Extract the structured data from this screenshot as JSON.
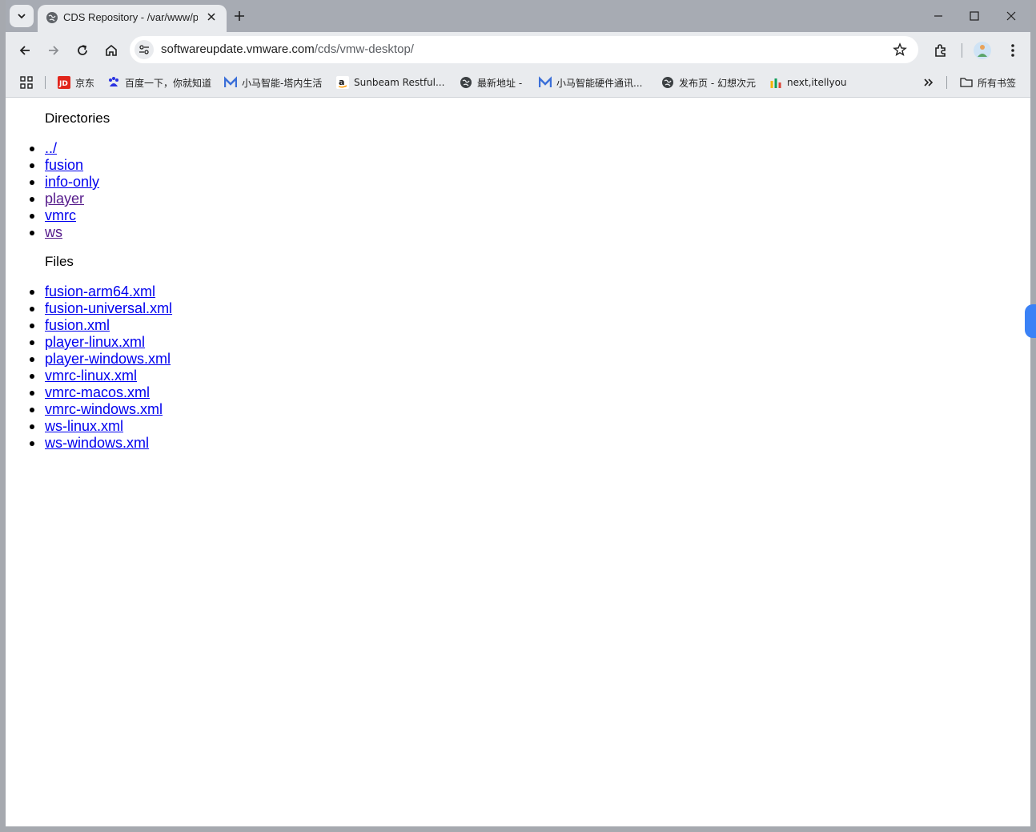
{
  "browser": {
    "tab_title": "CDS Repository - /var/www/public/stage/session-",
    "url_host": "softwareupdate.vmware.com",
    "url_path": "/cds/vmw-desktop/",
    "bookmarks": [
      {
        "label": "京东",
        "icon": "jd-icon"
      },
      {
        "label": "百度一下，你就知道",
        "icon": "baidu-icon"
      },
      {
        "label": "小马智能-塔内生活",
        "icon": "xiaoma-icon"
      },
      {
        "label": "Sunbeam Restful...",
        "icon": "amazon-icon"
      },
      {
        "label": "最新地址 -",
        "icon": "globe-icon"
      },
      {
        "label": "小马智能硬件通讯...",
        "icon": "xiaoma-icon"
      },
      {
        "label": "发布页 - 幻想次元",
        "icon": "globe-icon"
      },
      {
        "label": "next,itellyou",
        "icon": "itellyou-icon"
      }
    ],
    "all_bookmarks_label": "所有书签"
  },
  "page": {
    "directories_heading": "Directories",
    "directories": [
      {
        "label": "../",
        "visited": false
      },
      {
        "label": "fusion",
        "visited": false
      },
      {
        "label": "info-only",
        "visited": false
      },
      {
        "label": "player",
        "visited": true
      },
      {
        "label": "vmrc",
        "visited": false
      },
      {
        "label": "ws",
        "visited": true
      }
    ],
    "files_heading": "Files",
    "files": [
      "fusion-arm64.xml",
      "fusion-universal.xml",
      "fusion.xml",
      "player-linux.xml",
      "player-windows.xml",
      "vmrc-linux.xml",
      "vmrc-macos.xml",
      "vmrc-windows.xml",
      "ws-linux.xml",
      "ws-windows.xml"
    ]
  }
}
